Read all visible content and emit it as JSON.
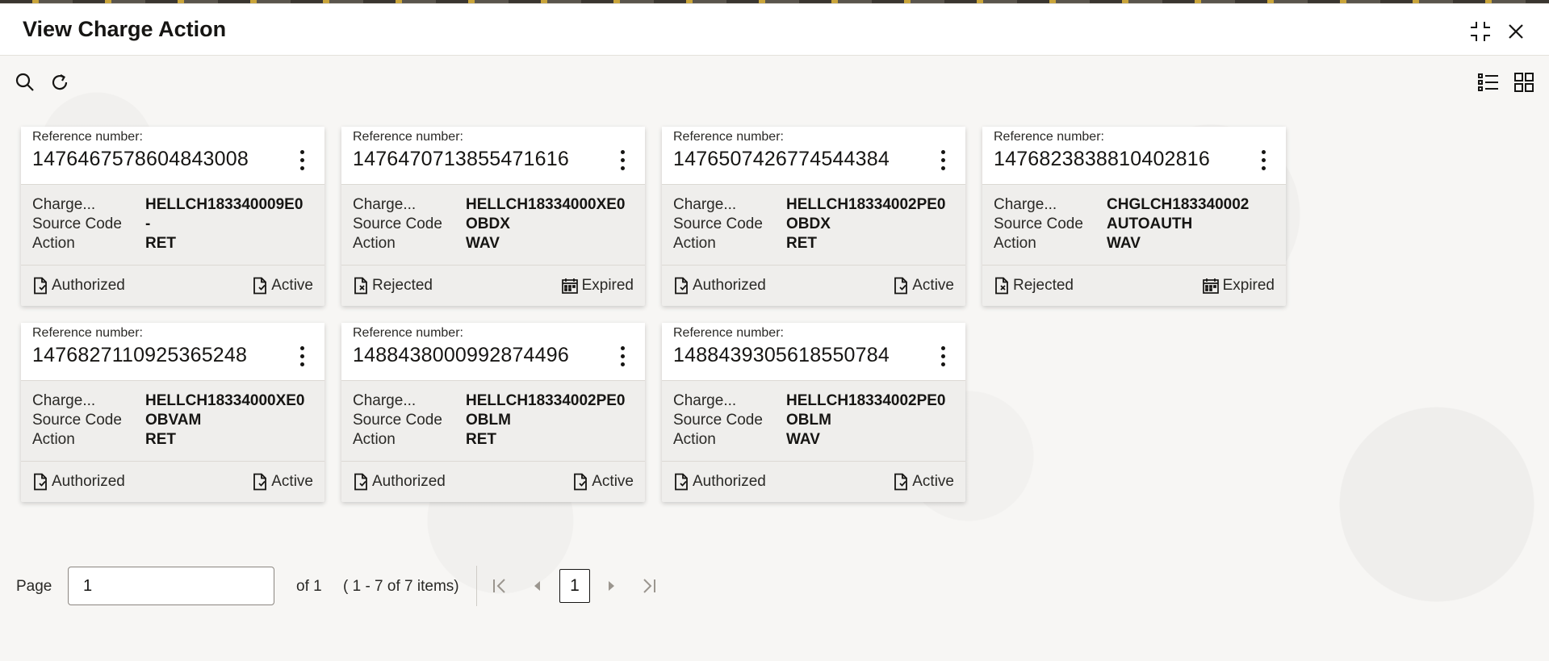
{
  "dialog": {
    "title": "View Charge Action"
  },
  "toolbar": {
    "search_icon": "search-icon",
    "refresh_icon": "refresh-icon",
    "list_view_icon": "list-view-icon",
    "grid_view_icon": "grid-view-icon"
  },
  "labels": {
    "reference": "Reference number:",
    "charge": "Charge...",
    "source_code": "Source Code",
    "action": "Action"
  },
  "cards": [
    {
      "ref": "1476467578604843008",
      "charge": "HELLCH183340009E0",
      "source": "-",
      "action": "RET",
      "auth": "Authorized",
      "status": "Active"
    },
    {
      "ref": "1476470713855471616",
      "charge": "HELLCH18334000XE0",
      "source": "OBDX",
      "action": "WAV",
      "auth": "Rejected",
      "status": "Expired"
    },
    {
      "ref": "1476507426774544384",
      "charge": "HELLCH18334002PE0",
      "source": "OBDX",
      "action": "RET",
      "auth": "Authorized",
      "status": "Active"
    },
    {
      "ref": "1476823838810402816",
      "charge": "CHGLCH183340002",
      "source": "AUTOAUTH",
      "action": "WAV",
      "auth": "Rejected",
      "status": "Expired"
    },
    {
      "ref": "1476827110925365248",
      "charge": "HELLCH18334000XE0",
      "source": "OBVAM",
      "action": "RET",
      "auth": "Authorized",
      "status": "Active"
    },
    {
      "ref": "1488438000992874496",
      "charge": "HELLCH18334002PE0",
      "source": "OBLM",
      "action": "RET",
      "auth": "Authorized",
      "status": "Active"
    },
    {
      "ref": "1488439305618550784",
      "charge": "HELLCH18334002PE0",
      "source": "OBLM",
      "action": "WAV",
      "auth": "Authorized",
      "status": "Active"
    }
  ],
  "pagination": {
    "page_label": "Page",
    "page_value": "1",
    "of_label": "of 1",
    "items_label": "( 1 - 7 of 7 items)",
    "current_page": "1"
  }
}
